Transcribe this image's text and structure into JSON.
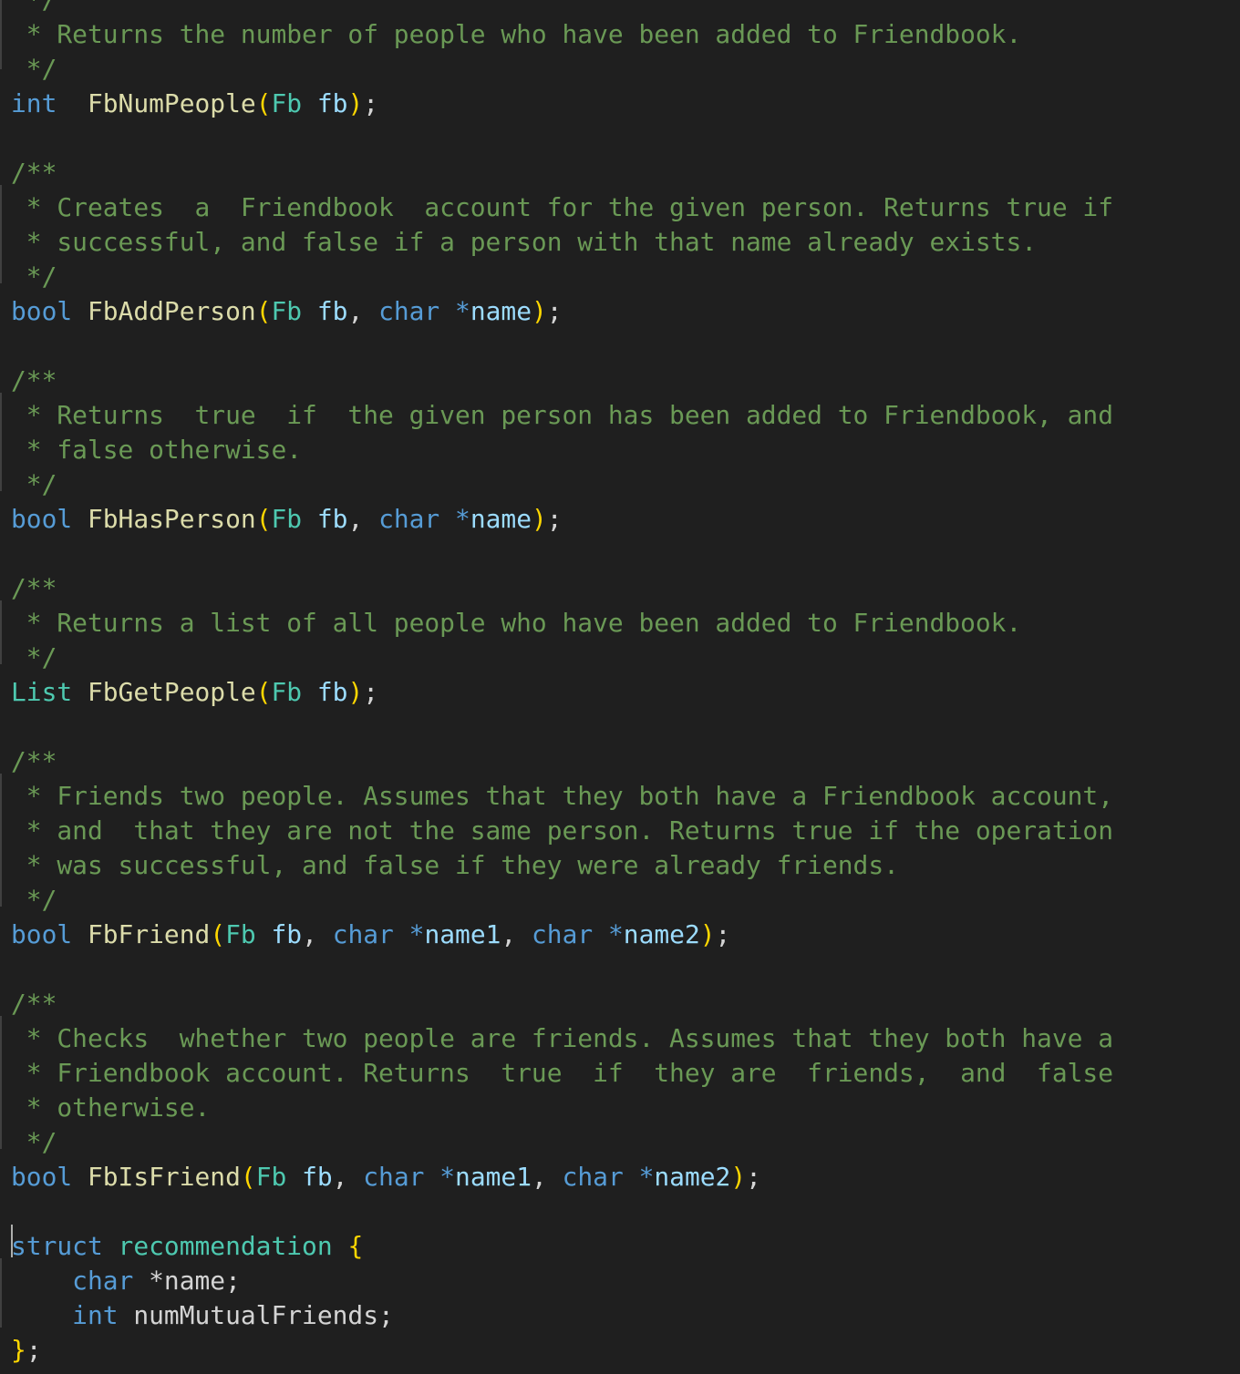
{
  "editor": {
    "lines": [
      [
        {
          "t": " */",
          "c": "cm"
        }
      ],
      [
        {
          "t": " * Returns the number of people who have been added to Friendbook.",
          "c": "cm"
        }
      ],
      [
        {
          "t": " */",
          "c": "cm"
        }
      ],
      [
        {
          "t": "int",
          "c": "kw"
        },
        {
          "t": "  "
        },
        {
          "t": "FbNumPeople",
          "c": "fn"
        },
        {
          "t": "(",
          "c": "br"
        },
        {
          "t": "Fb",
          "c": "ty"
        },
        {
          "t": " "
        },
        {
          "t": "fb",
          "c": "pr"
        },
        {
          "t": ")",
          "c": "br"
        },
        {
          "t": ";",
          "c": "pu"
        }
      ],
      [],
      [
        {
          "t": "/**",
          "c": "cm"
        }
      ],
      [
        {
          "t": " * Creates  a  Friendbook  account for the given person. Returns true if",
          "c": "cm"
        }
      ],
      [
        {
          "t": " * successful, and false if a person with that name already exists.",
          "c": "cm"
        }
      ],
      [
        {
          "t": " */",
          "c": "cm"
        }
      ],
      [
        {
          "t": "bool",
          "c": "kw"
        },
        {
          "t": " "
        },
        {
          "t": "FbAddPerson",
          "c": "fn"
        },
        {
          "t": "(",
          "c": "br"
        },
        {
          "t": "Fb",
          "c": "ty"
        },
        {
          "t": " "
        },
        {
          "t": "fb",
          "c": "pr"
        },
        {
          "t": ", ",
          "c": "pu"
        },
        {
          "t": "char",
          "c": "kw"
        },
        {
          "t": " "
        },
        {
          "t": "*",
          "c": "kw"
        },
        {
          "t": "name",
          "c": "pr"
        },
        {
          "t": ")",
          "c": "br"
        },
        {
          "t": ";",
          "c": "pu"
        }
      ],
      [],
      [
        {
          "t": "/**",
          "c": "cm"
        }
      ],
      [
        {
          "t": " * Returns  true  if  the given person has been added to Friendbook, and",
          "c": "cm"
        }
      ],
      [
        {
          "t": " * false otherwise.",
          "c": "cm"
        }
      ],
      [
        {
          "t": " */",
          "c": "cm"
        }
      ],
      [
        {
          "t": "bool",
          "c": "kw"
        },
        {
          "t": " "
        },
        {
          "t": "FbHasPerson",
          "c": "fn"
        },
        {
          "t": "(",
          "c": "br"
        },
        {
          "t": "Fb",
          "c": "ty"
        },
        {
          "t": " "
        },
        {
          "t": "fb",
          "c": "pr"
        },
        {
          "t": ", ",
          "c": "pu"
        },
        {
          "t": "char",
          "c": "kw"
        },
        {
          "t": " "
        },
        {
          "t": "*",
          "c": "kw"
        },
        {
          "t": "name",
          "c": "pr"
        },
        {
          "t": ")",
          "c": "br"
        },
        {
          "t": ";",
          "c": "pu"
        }
      ],
      [],
      [
        {
          "t": "/**",
          "c": "cm"
        }
      ],
      [
        {
          "t": " * Returns a list of all people who have been added to Friendbook.",
          "c": "cm"
        }
      ],
      [
        {
          "t": " */",
          "c": "cm"
        }
      ],
      [
        {
          "t": "List",
          "c": "ty"
        },
        {
          "t": " "
        },
        {
          "t": "FbGetPeople",
          "c": "fn"
        },
        {
          "t": "(",
          "c": "br"
        },
        {
          "t": "Fb",
          "c": "ty"
        },
        {
          "t": " "
        },
        {
          "t": "fb",
          "c": "pr"
        },
        {
          "t": ")",
          "c": "br"
        },
        {
          "t": ";",
          "c": "pu"
        }
      ],
      [],
      [
        {
          "t": "/**",
          "c": "cm"
        }
      ],
      [
        {
          "t": " * Friends two people. Assumes that they both have a Friendbook account,",
          "c": "cm"
        }
      ],
      [
        {
          "t": " * and  that they are not the same person. Returns true if the operation",
          "c": "cm"
        }
      ],
      [
        {
          "t": " * was successful, and false if they were already friends.",
          "c": "cm"
        }
      ],
      [
        {
          "t": " */",
          "c": "cm"
        }
      ],
      [
        {
          "t": "bool",
          "c": "kw"
        },
        {
          "t": " "
        },
        {
          "t": "FbFriend",
          "c": "fn"
        },
        {
          "t": "(",
          "c": "br"
        },
        {
          "t": "Fb",
          "c": "ty"
        },
        {
          "t": " "
        },
        {
          "t": "fb",
          "c": "pr"
        },
        {
          "t": ", ",
          "c": "pu"
        },
        {
          "t": "char",
          "c": "kw"
        },
        {
          "t": " "
        },
        {
          "t": "*",
          "c": "kw"
        },
        {
          "t": "name1",
          "c": "pr"
        },
        {
          "t": ", ",
          "c": "pu"
        },
        {
          "t": "char",
          "c": "kw"
        },
        {
          "t": " "
        },
        {
          "t": "*",
          "c": "kw"
        },
        {
          "t": "name2",
          "c": "pr"
        },
        {
          "t": ")",
          "c": "br"
        },
        {
          "t": ";",
          "c": "pu"
        }
      ],
      [],
      [
        {
          "t": "/**",
          "c": "cm"
        }
      ],
      [
        {
          "t": " * Checks  whether two people are friends. Assumes that they both have a",
          "c": "cm"
        }
      ],
      [
        {
          "t": " * Friendbook account. Returns  true  if  they are  friends,  and  false",
          "c": "cm"
        }
      ],
      [
        {
          "t": " * otherwise.",
          "c": "cm"
        }
      ],
      [
        {
          "t": " */",
          "c": "cm"
        }
      ],
      [
        {
          "t": "bool",
          "c": "kw"
        },
        {
          "t": " "
        },
        {
          "t": "FbIsFriend",
          "c": "fn"
        },
        {
          "t": "(",
          "c": "br"
        },
        {
          "t": "Fb",
          "c": "ty"
        },
        {
          "t": " "
        },
        {
          "t": "fb",
          "c": "pr"
        },
        {
          "t": ", ",
          "c": "pu"
        },
        {
          "t": "char",
          "c": "kw"
        },
        {
          "t": " "
        },
        {
          "t": "*",
          "c": "kw"
        },
        {
          "t": "name1",
          "c": "pr"
        },
        {
          "t": ", ",
          "c": "pu"
        },
        {
          "t": "char",
          "c": "kw"
        },
        {
          "t": " "
        },
        {
          "t": "*",
          "c": "kw"
        },
        {
          "t": "name2",
          "c": "pr"
        },
        {
          "t": ")",
          "c": "br"
        },
        {
          "t": ";",
          "c": "pu"
        }
      ],
      [],
      [
        {
          "t": "struct",
          "c": "kw"
        },
        {
          "t": " "
        },
        {
          "t": "recommendation",
          "c": "ty"
        },
        {
          "t": " "
        },
        {
          "t": "{",
          "c": "br"
        }
      ],
      [
        {
          "t": "    "
        },
        {
          "t": "char",
          "c": "kw"
        },
        {
          "t": " *name;",
          "c": "pu"
        }
      ],
      [
        {
          "t": "    "
        },
        {
          "t": "int",
          "c": "kw"
        },
        {
          "t": " numMutualFriends;",
          "c": "pu"
        }
      ],
      [
        {
          "t": "}",
          "c": "br"
        },
        {
          "t": ";",
          "c": "pu"
        }
      ]
    ]
  },
  "colors": {
    "background": "#1f1f1f",
    "comment": "#6a9955",
    "keyword": "#569cd6",
    "type": "#4ec9b0",
    "function": "#dcdcaa",
    "parameter": "#9cdcfe",
    "bracket": "#ffd700",
    "text": "#d4d4d4"
  }
}
